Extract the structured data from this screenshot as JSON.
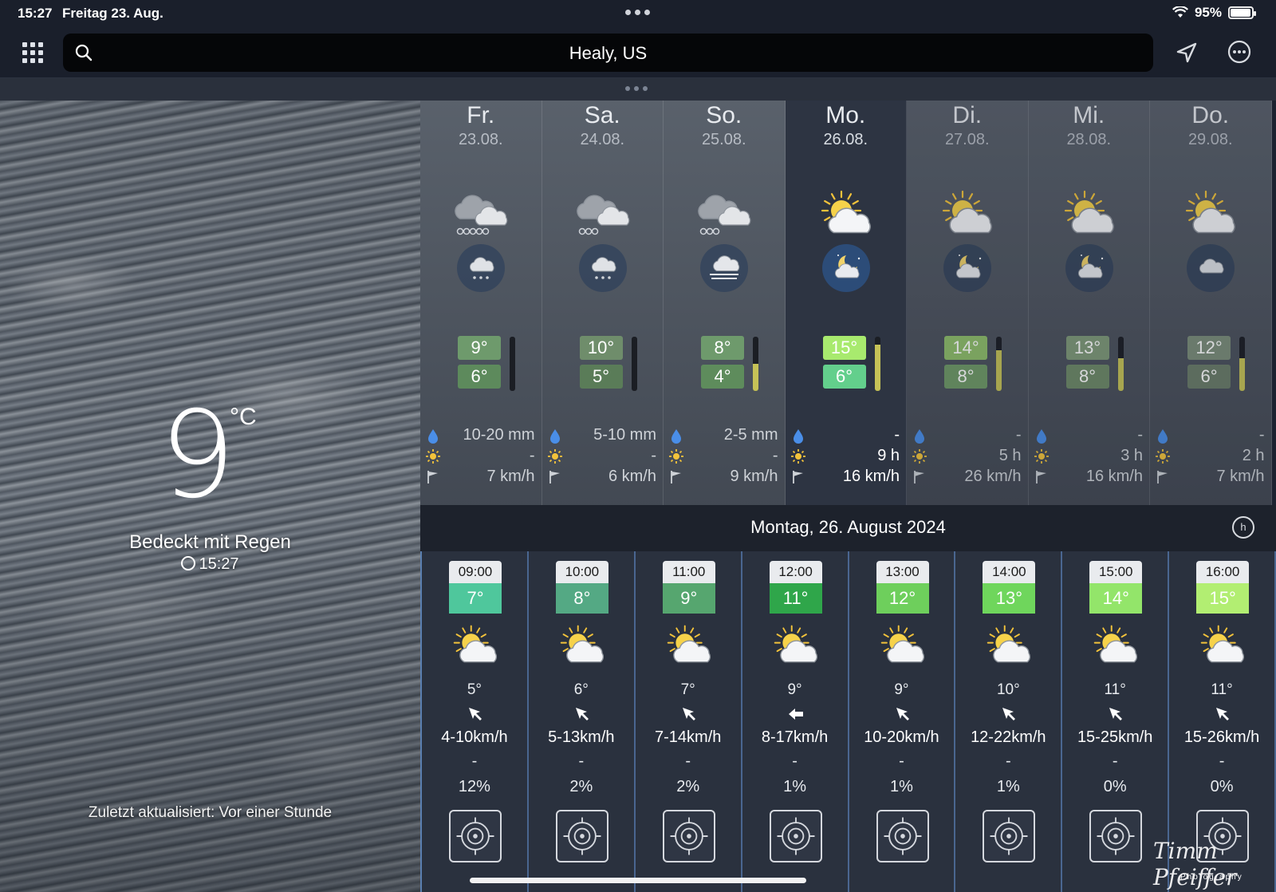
{
  "status_bar": {
    "time": "15:27",
    "date": "Freitag 23. Aug.",
    "battery": "95%",
    "battery_level": 0.95
  },
  "search": {
    "location": "Healy, US"
  },
  "current": {
    "temperature": "9",
    "unit": "°C",
    "condition": "Bedeckt mit Regen",
    "observed_time": "15:27",
    "updated": "Zuletzt aktualisiert: Vor einer Stunde"
  },
  "days": [
    {
      "name": "Fr.",
      "date": "23.08.",
      "icon": "cloud-heavy-rain-icon",
      "night_icon": "night-cloud-rain-icon",
      "high": "9°",
      "low": "6°",
      "high_color": "#6e9a6c",
      "low_color": "#5d8a5c",
      "precip": "10-20 mm",
      "sun": "-",
      "wind": "7 km/h",
      "bar_level": 0.0,
      "selected": false
    },
    {
      "name": "Sa.",
      "date": "24.08.",
      "icon": "cloud-rain-icon",
      "night_icon": "night-cloud-rain-icon",
      "high": "10°",
      "low": "5°",
      "high_color": "#6f8d6b",
      "low_color": "#5a7c58",
      "precip": "5-10 mm",
      "sun": "-",
      "wind": "6 km/h",
      "bar_level": 0.0,
      "selected": false
    },
    {
      "name": "So.",
      "date": "25.08.",
      "icon": "cloud-rain-icon",
      "night_icon": "night-fog-icon",
      "high": "8°",
      "low": "4°",
      "high_color": "#6e9a6c",
      "low_color": "#5e8c5c",
      "precip": "2-5 mm",
      "sun": "-",
      "wind": "9 km/h",
      "bar_level": 0.5,
      "selected": false
    },
    {
      "name": "Mo.",
      "date": "26.08.",
      "icon": "sun-cloud-icon",
      "night_icon": "moon-cloud-icon",
      "high": "15°",
      "low": "6°",
      "high_color": "#a8ea6e",
      "low_color": "#63cf8c",
      "precip": "-",
      "sun": "9 h",
      "wind": "16 km/h",
      "bar_level": 0.85,
      "selected": true
    },
    {
      "name": "Di.",
      "date": "27.08.",
      "icon": "sun-cloud-icon",
      "night_icon": "moon-cloud-icon",
      "high": "14°",
      "low": "8°",
      "high_color": "#8fbf6a",
      "low_color": "#6f9a66",
      "precip": "-",
      "sun": "5 h",
      "wind": "26 km/h",
      "bar_level": 0.75,
      "selected": false
    },
    {
      "name": "Mi.",
      "date": "28.08.",
      "icon": "sun-cloud-icon",
      "night_icon": "moon-cloud-icon",
      "high": "13°",
      "low": "8°",
      "high_color": "#7f9a78",
      "low_color": "#6e8a68",
      "precip": "-",
      "sun": "3 h",
      "wind": "16 km/h",
      "bar_level": 0.6,
      "selected": false
    },
    {
      "name": "Do.",
      "date": "29.08.",
      "icon": "sun-cloud-icon",
      "night_icon": "night-cloud-icon",
      "high": "12°",
      "low": "6°",
      "high_color": "#7c8e7a",
      "low_color": "#6b7d69",
      "precip": "-",
      "sun": "2 h",
      "wind": "7 km/h",
      "bar_level": 0.6,
      "selected": false
    }
  ],
  "selected_date": "Montag, 26. August 2024",
  "hours_button": "h",
  "hours": [
    {
      "time": "09:00",
      "temp": "7°",
      "color": "#4fc79c",
      "icon": "sun-cloud-icon",
      "feels": "5°",
      "arrow": "wind-arrow-icon",
      "wind": "4-10km/h",
      "rain": "-",
      "prob": "12%"
    },
    {
      "time": "10:00",
      "temp": "8°",
      "color": "#54a984",
      "icon": "sun-cloud-icon",
      "feels": "6°",
      "arrow": "wind-arrow-icon",
      "wind": "5-13km/h",
      "rain": "-",
      "prob": "2%"
    },
    {
      "time": "11:00",
      "temp": "9°",
      "color": "#56a66f",
      "icon": "sun-cloud-icon",
      "feels": "7°",
      "arrow": "wind-arrow-icon",
      "wind": "7-14km/h",
      "rain": "-",
      "prob": "2%"
    },
    {
      "time": "12:00",
      "temp": "11°",
      "color": "#2fa64a",
      "icon": "sun-cloud-icon",
      "feels": "9°",
      "arrow": "wind-arrow-left-icon",
      "wind": "8-17km/h",
      "rain": "-",
      "prob": "1%"
    },
    {
      "time": "13:00",
      "temp": "12°",
      "color": "#6ecf5c",
      "icon": "sun-cloud-icon",
      "feels": "9°",
      "arrow": "wind-arrow-icon",
      "wind": "10-20km/h",
      "rain": "-",
      "prob": "1%"
    },
    {
      "time": "14:00",
      "temp": "13°",
      "color": "#6fd65c",
      "icon": "sun-cloud-icon",
      "feels": "10°",
      "arrow": "wind-arrow-icon",
      "wind": "12-22km/h",
      "rain": "-",
      "prob": "1%"
    },
    {
      "time": "15:00",
      "temp": "14°",
      "color": "#93e56a",
      "icon": "sun-cloud-icon",
      "feels": "11°",
      "arrow": "wind-arrow-icon",
      "wind": "15-25km/h",
      "rain": "-",
      "prob": "0%"
    },
    {
      "time": "16:00",
      "temp": "15°",
      "color": "#b2ee72",
      "icon": "sun-cloud-icon",
      "feels": "11°",
      "arrow": "wind-arrow-icon",
      "wind": "15-26km/h",
      "rain": "-",
      "prob": "0%"
    }
  ],
  "watermark": {
    "name": "Timm Pfeiffer",
    "sub": "Photography"
  }
}
